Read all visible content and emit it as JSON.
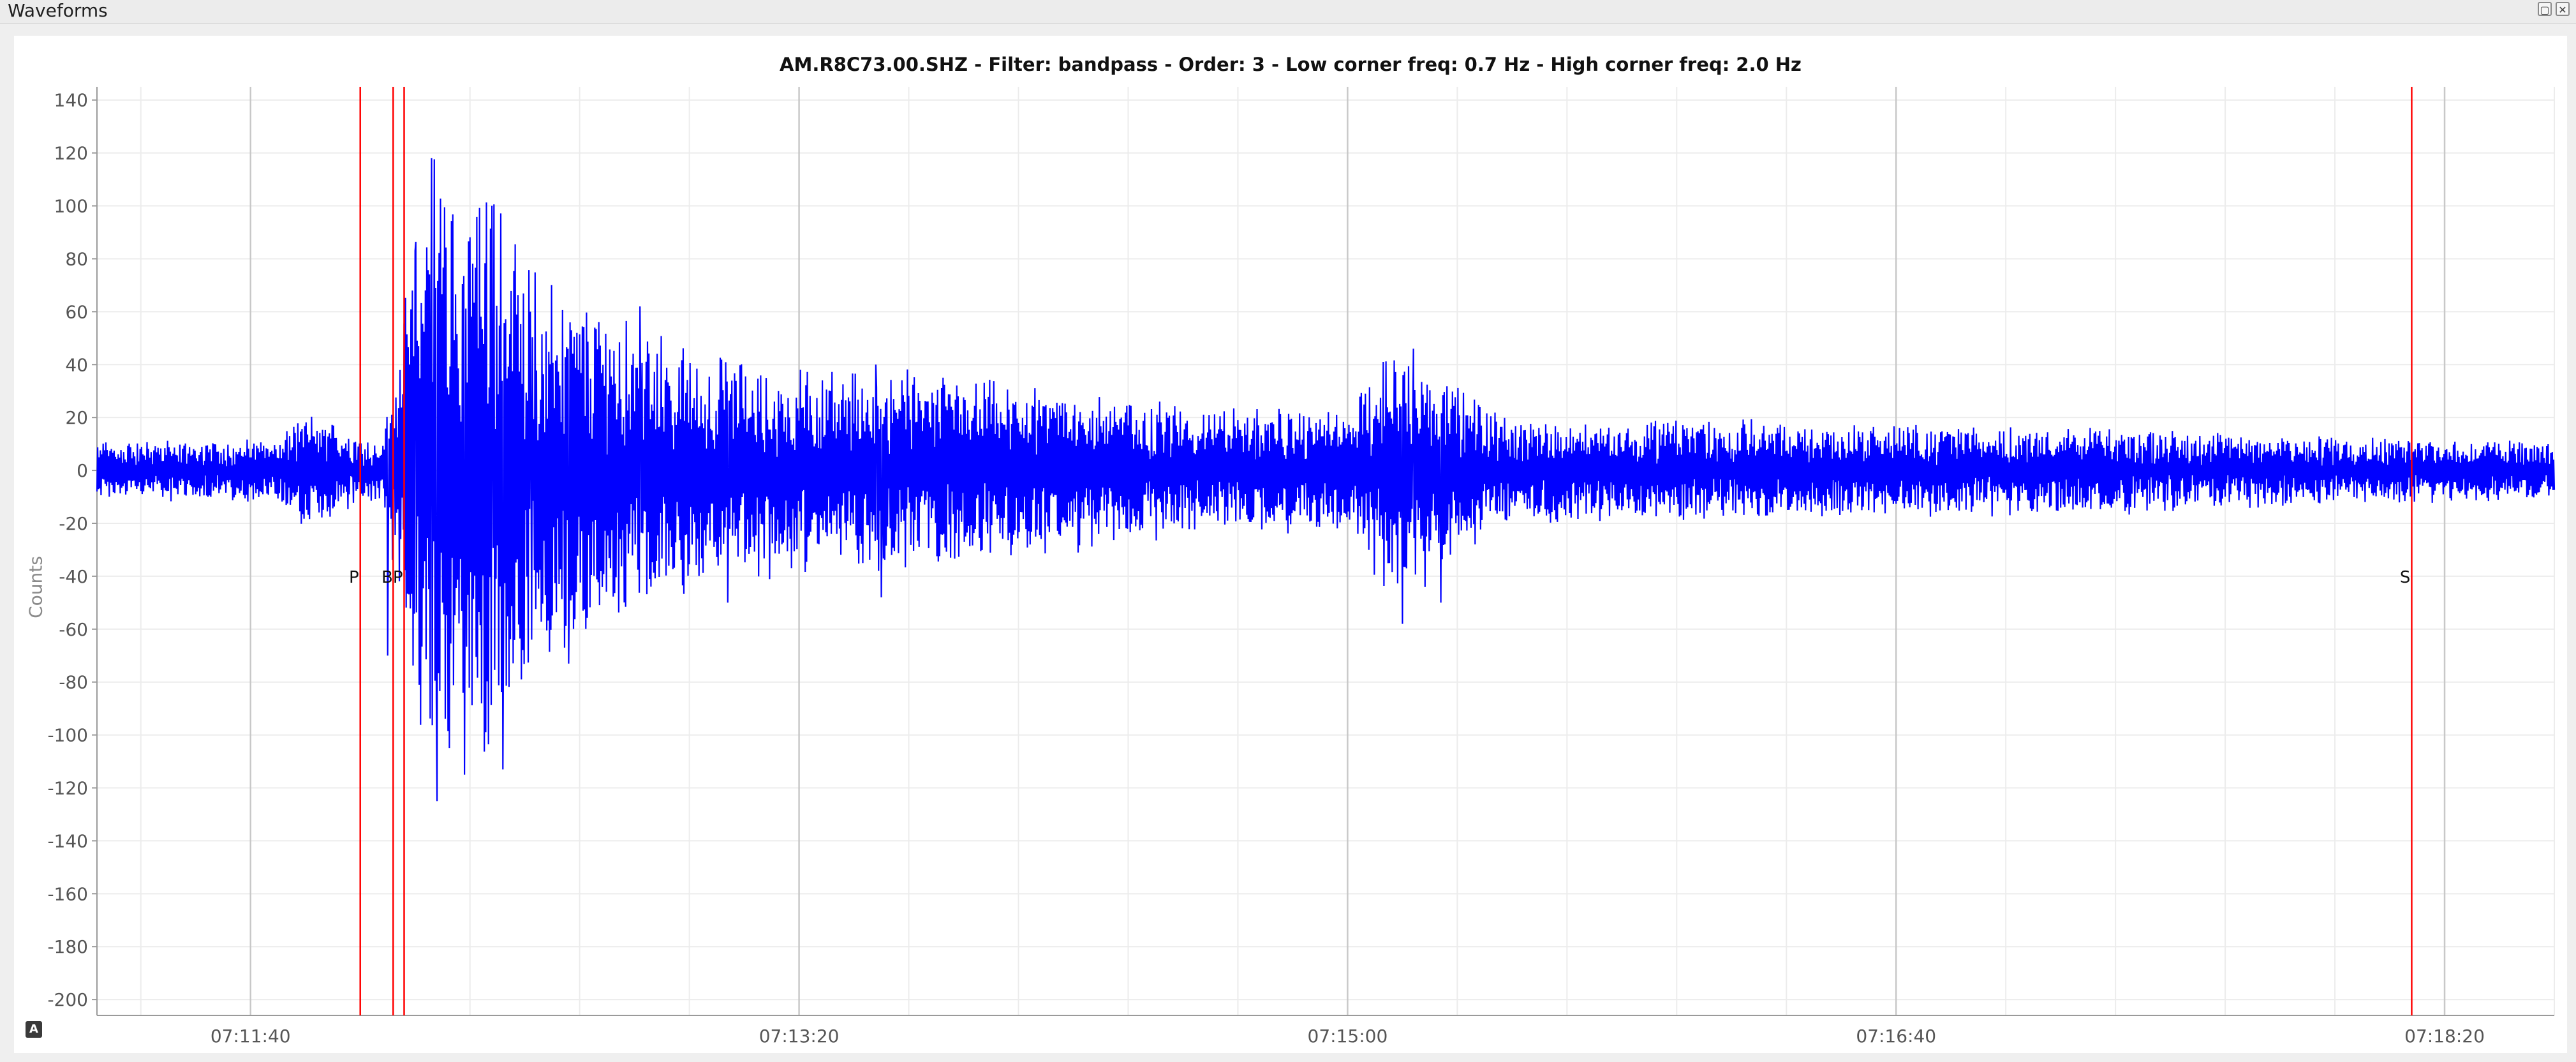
{
  "window": {
    "title": "Waveforms",
    "restore_icon": "restore-icon",
    "close_icon": "close-icon"
  },
  "autoscale_button": {
    "label": "A"
  },
  "colors": {
    "trace": "#0000ff",
    "pick": "#ff0000",
    "grid_major": "#c8c8c8",
    "grid_minor": "#ececec",
    "axis": "#9a9a9a"
  },
  "chart_data": {
    "type": "line",
    "title": "AM.R8C73.00.SHZ - Filter: bandpass - Order: 3 - Low corner freq: 0.7 Hz - High corner freq: 2.0 Hz",
    "xlabel": "",
    "ylabel": "Counts",
    "xlim": [
      "07:11:12",
      "07:18:40"
    ],
    "ylim": [
      -206,
      145
    ],
    "yticks": [
      140,
      120,
      100,
      80,
      60,
      40,
      20,
      0,
      -20,
      -40,
      -60,
      -80,
      -100,
      -120,
      -140,
      -160,
      -180,
      -200
    ],
    "xticks": [
      "07:11:40",
      "07:13:20",
      "07:15:00",
      "07:16:40",
      "07:18:20"
    ],
    "grid": true,
    "series": [
      {
        "name": "",
        "sampling": "envelope of noisy waveform (counts), one sample per ~1 s",
        "envelope": [
          [
            "07:11:12",
            10
          ],
          [
            "07:11:45",
            11
          ],
          [
            "07:11:50",
            20
          ],
          [
            "07:12:04",
            10
          ],
          [
            "07:12:06",
            35
          ],
          [
            "07:12:10",
            80
          ],
          [
            "07:12:14",
            118
          ],
          [
            "07:12:18",
            95
          ],
          [
            "07:12:22",
            100
          ],
          [
            "07:12:26",
            95
          ],
          [
            "07:12:32",
            70
          ],
          [
            "07:12:40",
            60
          ],
          [
            "07:12:50",
            50
          ],
          [
            "07:13:00",
            42
          ],
          [
            "07:13:20",
            35
          ],
          [
            "07:13:40",
            34
          ],
          [
            "07:14:00",
            30
          ],
          [
            "07:14:20",
            26
          ],
          [
            "07:14:40",
            22
          ],
          [
            "07:15:00",
            20
          ],
          [
            "07:15:06",
            40
          ],
          [
            "07:15:12",
            45
          ],
          [
            "07:15:18",
            32
          ],
          [
            "07:15:30",
            18
          ],
          [
            "07:16:00",
            18
          ],
          [
            "07:16:40",
            16
          ],
          [
            "07:17:20",
            15
          ],
          [
            "07:18:00",
            12
          ],
          [
            "07:18:40",
            10
          ]
        ],
        "extrema": [
          [
            "07:12:05",
            -70
          ],
          [
            "07:12:10",
            83
          ],
          [
            "07:12:13",
            118
          ],
          [
            "07:12:14",
            -125
          ],
          [
            "07:12:19",
            -115
          ],
          [
            "07:12:24",
            100
          ],
          [
            "07:12:26",
            -113
          ],
          [
            "07:12:31",
            60
          ],
          [
            "07:12:38",
            -73
          ],
          [
            "07:12:51",
            62
          ],
          [
            "07:13:07",
            -50
          ],
          [
            "07:13:34",
            40
          ],
          [
            "07:13:35",
            -48
          ],
          [
            "07:15:10",
            -58
          ],
          [
            "07:15:12",
            46
          ],
          [
            "07:15:17",
            -50
          ]
        ]
      }
    ],
    "picks": [
      {
        "label": "P",
        "time": "07:12:00"
      },
      {
        "label": "",
        "time": "07:12:06"
      },
      {
        "label": "BP",
        "time": "07:12:08"
      },
      {
        "label": "S",
        "time": "07:18:14"
      }
    ]
  }
}
